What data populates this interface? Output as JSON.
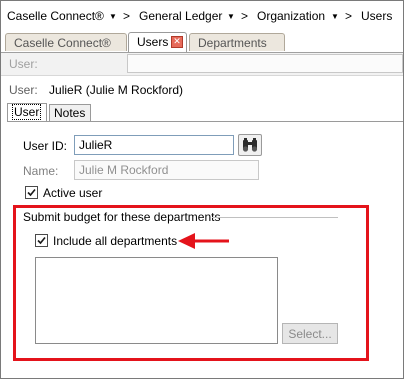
{
  "breadcrumb": {
    "items": [
      "Caselle Connect®",
      "General Ledger",
      "Organization",
      "Users"
    ],
    "separator": ">"
  },
  "tabs": [
    {
      "label": "Caselle Connect®",
      "active": false
    },
    {
      "label": "Users",
      "active": true,
      "closable": true
    },
    {
      "label": "Departments",
      "active": false
    }
  ],
  "filter": {
    "label": "User:",
    "value": ""
  },
  "summary": {
    "key": "User:",
    "value": "JulieR  (Julie M Rockford)"
  },
  "subtabs": [
    {
      "label": "User",
      "active": true
    },
    {
      "label": "Notes",
      "active": false
    }
  ],
  "form": {
    "user_id_label": "User ID:",
    "user_id_value": "JulieR",
    "name_label": "Name:",
    "name_value": "Julie M Rockford",
    "active_user_label": "Active user",
    "active_user_checked": true
  },
  "departments_group": {
    "title": "Submit budget for these departments",
    "include_all_label": "Include all departments",
    "include_all_checked": true,
    "items": [],
    "select_button_label": "Select..."
  },
  "colors": {
    "highlight": "#e4131b",
    "close_tab": "#e66a5a",
    "tab_inactive": "#ece7de"
  }
}
